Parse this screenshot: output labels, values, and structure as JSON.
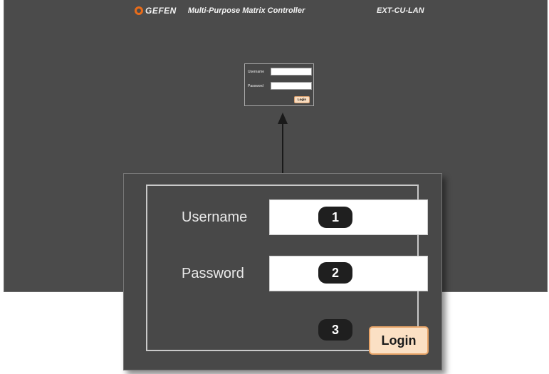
{
  "header": {
    "brand": "GEFEN",
    "title": "Multi-Purpose Matrix Controller",
    "model": "EXT-CU-LAN"
  },
  "mini_form": {
    "username_label": "Username",
    "password_label": "Password",
    "login_label": "Login"
  },
  "zoom_form": {
    "username_label": "Username",
    "password_label": "Password",
    "login_label": "Login",
    "callouts": [
      "1",
      "2",
      "3"
    ]
  },
  "colors": {
    "screen_bg": "#4b4b4b",
    "logo_accent": "#e86c1a",
    "login_button_bg": "#fbe0c4"
  }
}
